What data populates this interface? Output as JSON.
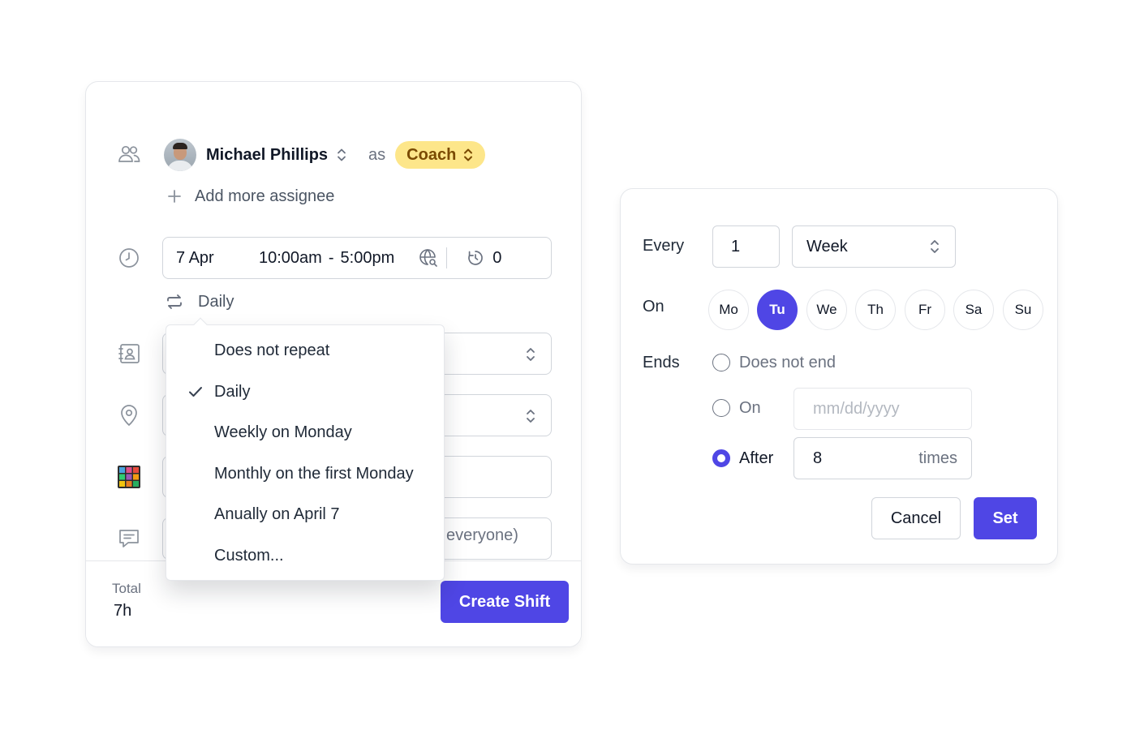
{
  "shift_form": {
    "assignee": {
      "name": "Michael Phillips",
      "as_word": "as",
      "role": "Coach"
    },
    "add_assignee_label": "Add more assignee",
    "time": {
      "date": "7 Apr",
      "start": "10:00am",
      "separator": "-",
      "end": "5:00pm",
      "break_minutes": "0"
    },
    "repeat": {
      "current": "Daily"
    },
    "note_placeholder_tail": "everyone)",
    "footer": {
      "total_label": "Total",
      "total_value": "7h",
      "create_label": "Create Shift"
    }
  },
  "repeat_dropdown": {
    "options": [
      {
        "label": "Does not repeat",
        "selected": false
      },
      {
        "label": "Daily",
        "selected": true
      },
      {
        "label": "Weekly on Monday",
        "selected": false
      },
      {
        "label": "Monthly on the first Monday",
        "selected": false
      },
      {
        "label": "Anually on April 7",
        "selected": false
      },
      {
        "label": "Custom...",
        "selected": false
      }
    ]
  },
  "custom_recurrence": {
    "every_label": "Every",
    "every_value": "1",
    "unit": "Week",
    "on_label": "On",
    "days": [
      {
        "label": "Mo",
        "selected": false
      },
      {
        "label": "Tu",
        "selected": true
      },
      {
        "label": "We",
        "selected": false
      },
      {
        "label": "Th",
        "selected": false
      },
      {
        "label": "Fr",
        "selected": false
      },
      {
        "label": "Sa",
        "selected": false
      },
      {
        "label": "Su",
        "selected": false
      }
    ],
    "ends_label": "Ends",
    "ends_options": {
      "never": "Does not end",
      "on": "On",
      "on_placeholder": "mm/dd/yyyy",
      "after": "After",
      "after_value": "8",
      "after_suffix": "times",
      "selected": "after"
    },
    "cancel_label": "Cancel",
    "set_label": "Set"
  },
  "colors": {
    "accent": "#4f46e5",
    "role_pill_bg": "#fde68a",
    "role_pill_text": "#7a4a00",
    "border": "#d1d5db",
    "muted_text": "#6b7280"
  },
  "icons": {
    "assignee_row": "people-icon",
    "time_row": "clock-icon",
    "repeat": "repeat-icon",
    "position_row": "contact-card-icon",
    "location_row": "location-pin-icon",
    "color_row": "color-grid-icon",
    "note_row": "chat-icon",
    "timezone": "timezone-search-icon",
    "break": "timer-icon"
  }
}
